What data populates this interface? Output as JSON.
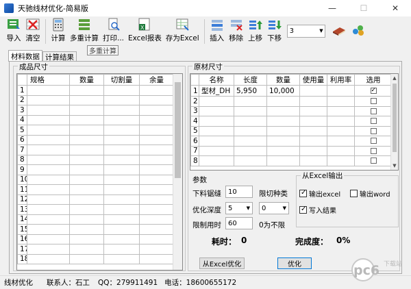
{
  "window": {
    "title": "天驰线材优化-简易版",
    "minimize": "—",
    "maximize": "☐",
    "close": "✕"
  },
  "toolbar": {
    "import": "导入",
    "clear": "清空",
    "calc": "计算",
    "multi_calc": "多重计算",
    "print": "打印...",
    "excel_report": "Excel报表",
    "save_excel": "存为Excel",
    "insert": "插入",
    "remove": "移除",
    "move_up": "上移",
    "move_down": "下移",
    "combo_value": "3"
  },
  "tooltip": "多重计算",
  "tabs": [
    "材料数据",
    "计算结果"
  ],
  "product": {
    "title": "成品尺寸",
    "headers": [
      "规格",
      "数量",
      "切割量",
      "余量"
    ],
    "rows": [
      "1",
      "2",
      "3",
      "4",
      "5",
      "6",
      "7",
      "8",
      "9",
      "10",
      "11",
      "12",
      "13",
      "14",
      "15",
      "16",
      "17",
      "18"
    ]
  },
  "raw": {
    "title": "原材尺寸",
    "headers": [
      "名称",
      "长度",
      "数量",
      "使用量",
      "利用率",
      "选用"
    ],
    "rows": [
      {
        "n": "1",
        "name": "型材_DH",
        "len": "5,950",
        "qty": "10,000",
        "sel": true
      },
      {
        "n": "2",
        "name": "",
        "len": "",
        "qty": "",
        "sel": false
      },
      {
        "n": "3",
        "name": "",
        "len": "",
        "qty": "",
        "sel": false
      },
      {
        "n": "4",
        "name": "",
        "len": "",
        "qty": "",
        "sel": false
      },
      {
        "n": "5",
        "name": "",
        "len": "",
        "qty": "",
        "sel": false
      },
      {
        "n": "6",
        "name": "",
        "len": "",
        "qty": "",
        "sel": false
      },
      {
        "n": "7",
        "name": "",
        "len": "",
        "qty": "",
        "sel": false
      },
      {
        "n": "8",
        "name": "",
        "len": "",
        "qty": "",
        "sel": false
      }
    ]
  },
  "params": {
    "title": "参数",
    "kerf_label": "下料锯缝",
    "kerf": "10",
    "limit_type_label": "限切种类",
    "depth_label": "优化深度",
    "depth": "5",
    "limit_type": "0",
    "time_label": "限制用时",
    "time": "60",
    "no_limit": "0为不限"
  },
  "excel_out": {
    "title": "从Excel输出",
    "out_excel": "输出excel",
    "out_word": "输出word",
    "write_result": "写入结果"
  },
  "result": {
    "time_label": "耗时：",
    "time_val": "0",
    "done_label": "完成度：",
    "done_val": "0%"
  },
  "buttons": {
    "from_excel": "从Excel优化",
    "optimize": "优化",
    "other": "优化"
  },
  "status": {
    "app": "线材优化",
    "contact": "联系人：石工",
    "qq": "QQ：279911491",
    "phone": "电话：18600655172"
  },
  "watermark": {
    "text": "pc6",
    "sub": "下载站"
  }
}
